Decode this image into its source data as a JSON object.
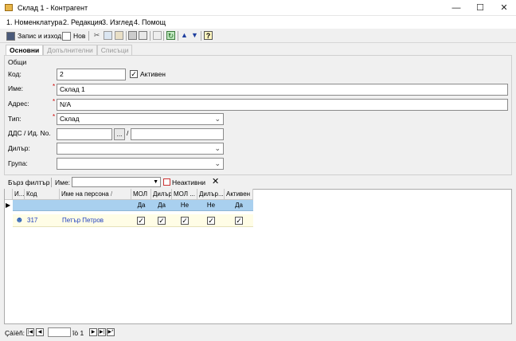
{
  "window": {
    "title": "Склад 1 - Контрагент"
  },
  "menu": [
    "1. Номенклатура",
    "2. Редакция",
    "3. Изглед",
    "4. Помощ"
  ],
  "toolbar": {
    "save_exit": "Запис и изход",
    "new": "Нов"
  },
  "tabs": [
    "Основни",
    "Допълнителни",
    "Списъци"
  ],
  "form": {
    "group": "Общи",
    "code_label": "Код:",
    "code_value": "2",
    "active_label": "Активен",
    "active_checked": true,
    "name_label": "Име:",
    "name_value": "Склад 1",
    "address_label": "Адрес:",
    "address_value": "N/A",
    "type_label": "Тип:",
    "type_value": "Склад",
    "vat_label": "ДДС / Ид. No.",
    "vat_value": "",
    "vat_sep": "/",
    "id_value": "",
    "browse": "...",
    "dealer_label": "Дилър:",
    "dealer_value": "",
    "group_label": "Група:",
    "group_value": ""
  },
  "filter": {
    "quick": "Бърз филтър",
    "name_label": "Име:",
    "name_value": "",
    "inactive": "Неактивни"
  },
  "grid": {
    "columns": [
      "И...",
      "Код",
      "Име на персона",
      "МОЛ",
      "Дилър",
      "МОЛ ...",
      "Дилър...",
      "Активен"
    ],
    "sort_indicator": "/",
    "filter_row": [
      "",
      "",
      "",
      "Да",
      "Да",
      "Не",
      "Не",
      "Да"
    ],
    "rows": [
      {
        "code": "317",
        "name": "Петър Петров",
        "mol": true,
        "dealer": true,
        "mol2": true,
        "dealer2": true,
        "active": true
      }
    ]
  },
  "status": {
    "label": "Çàïèñ:",
    "page_value": "",
    "of_text": "îò 1"
  },
  "colors": {
    "filter_row": "#a9d0ef",
    "data_row": "#fffde6",
    "link": "#1f3fbf"
  }
}
